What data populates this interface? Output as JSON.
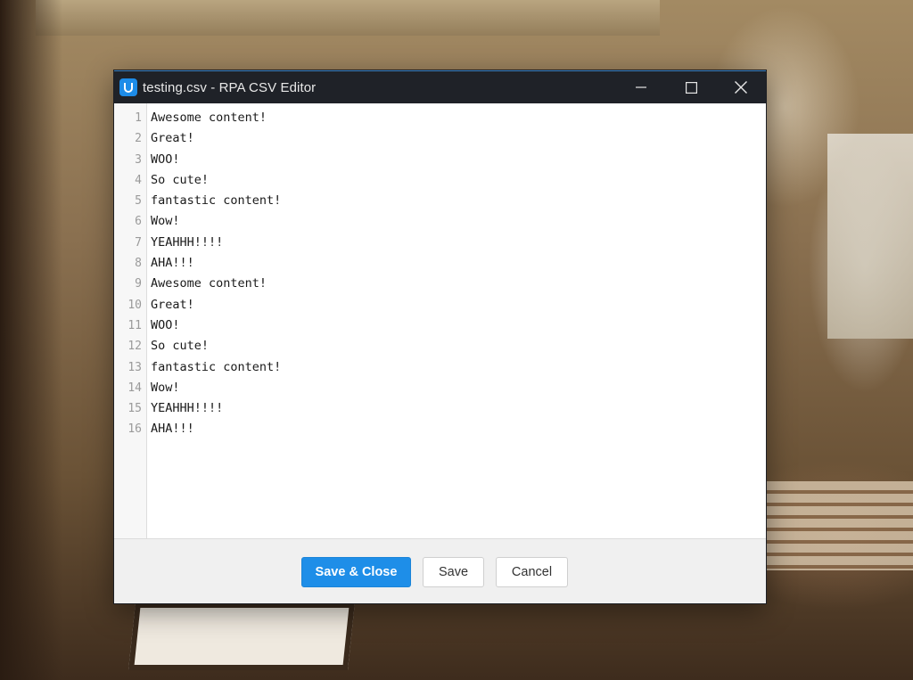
{
  "window": {
    "title": "testing.csv - RPA CSV Editor",
    "app_icon": "uipath-icon",
    "controls": [
      "minimize-icon",
      "maximize-icon",
      "close-icon"
    ]
  },
  "editor": {
    "line_numbers": [
      "1",
      "2",
      "3",
      "4",
      "5",
      "6",
      "7",
      "8",
      "9",
      "10",
      "11",
      "12",
      "13",
      "14",
      "15",
      "16"
    ],
    "lines": [
      "Awesome content!",
      "Great!",
      "WOO!",
      "So cute!",
      "fantastic content!",
      "Wow!",
      "YEAHHH!!!!",
      "AHA!!!",
      "Awesome content!",
      "Great!",
      "WOO!",
      "So cute!",
      "fantastic content!",
      "Wow!",
      "YEAHHH!!!!",
      "AHA!!!"
    ]
  },
  "footer": {
    "save_close_label": "Save & Close",
    "save_label": "Save",
    "cancel_label": "Cancel"
  },
  "colors": {
    "accent": "#1e8ee8",
    "titlebar": "#1f2228"
  }
}
